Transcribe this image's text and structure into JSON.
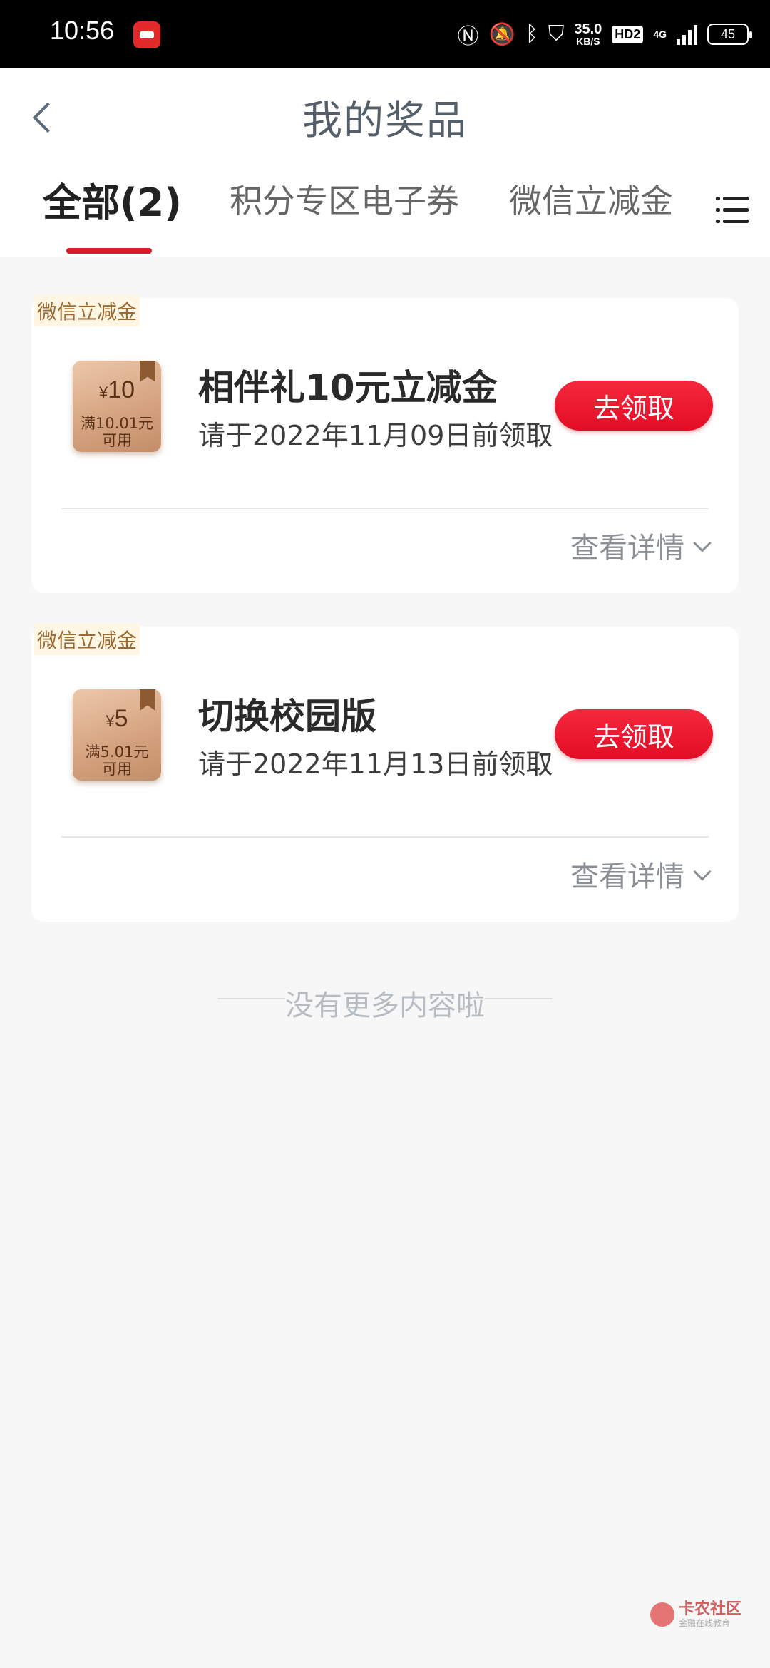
{
  "status_bar": {
    "time": "10:56",
    "speed_value": "35.0",
    "speed_unit": "KB/S",
    "hd_label": "HD2",
    "network_label": "4G",
    "battery": "45"
  },
  "header": {
    "title": "我的奖品",
    "tabs": [
      {
        "label": "全部(2)",
        "active": true
      },
      {
        "label": "积分专区电子券",
        "active": false
      },
      {
        "label": "微信立减金",
        "active": false
      }
    ]
  },
  "prizes": [
    {
      "tag": "微信立减金",
      "coupon_currency": "¥",
      "coupon_amount": "10",
      "coupon_condition_1": "满10.01元",
      "coupon_condition_2": "可用",
      "name": "相伴礼10元立减金",
      "deadline": "请于2022年11月09日前领取",
      "button": "去领取",
      "details": "查看详情"
    },
    {
      "tag": "微信立减金",
      "coupon_currency": "¥",
      "coupon_amount": "5",
      "coupon_condition_1": "满5.01元",
      "coupon_condition_2": "可用",
      "name": "切换校园版",
      "deadline": "请于2022年11月13日前领取",
      "button": "去领取",
      "details": "查看详情"
    }
  ],
  "footer": {
    "no_more": "没有更多内容啦"
  },
  "watermark": {
    "main": "卡农社区",
    "sub": "金融在线教育"
  },
  "colors": {
    "accent": "#d91c2b",
    "button": "#e8132a",
    "tag_text": "#9b6a32"
  }
}
